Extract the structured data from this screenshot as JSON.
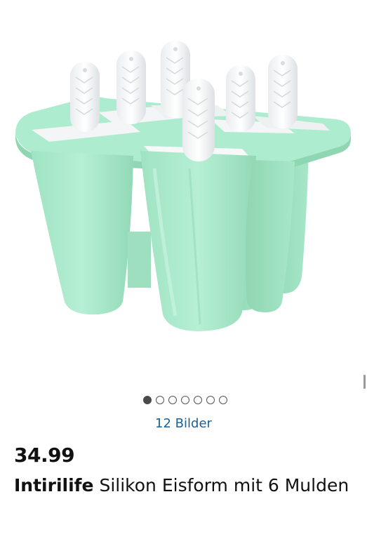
{
  "gallery": {
    "image_count_label": "12 Bilder",
    "total_dots": 7,
    "active_dot": 0
  },
  "product": {
    "price": "34.99",
    "brand": "Intirilife",
    "name": "Silikon Eisform mit 6 Mulden"
  },
  "colors": {
    "mold_green": "#a8e8c9",
    "link_blue": "#1b5f96"
  }
}
